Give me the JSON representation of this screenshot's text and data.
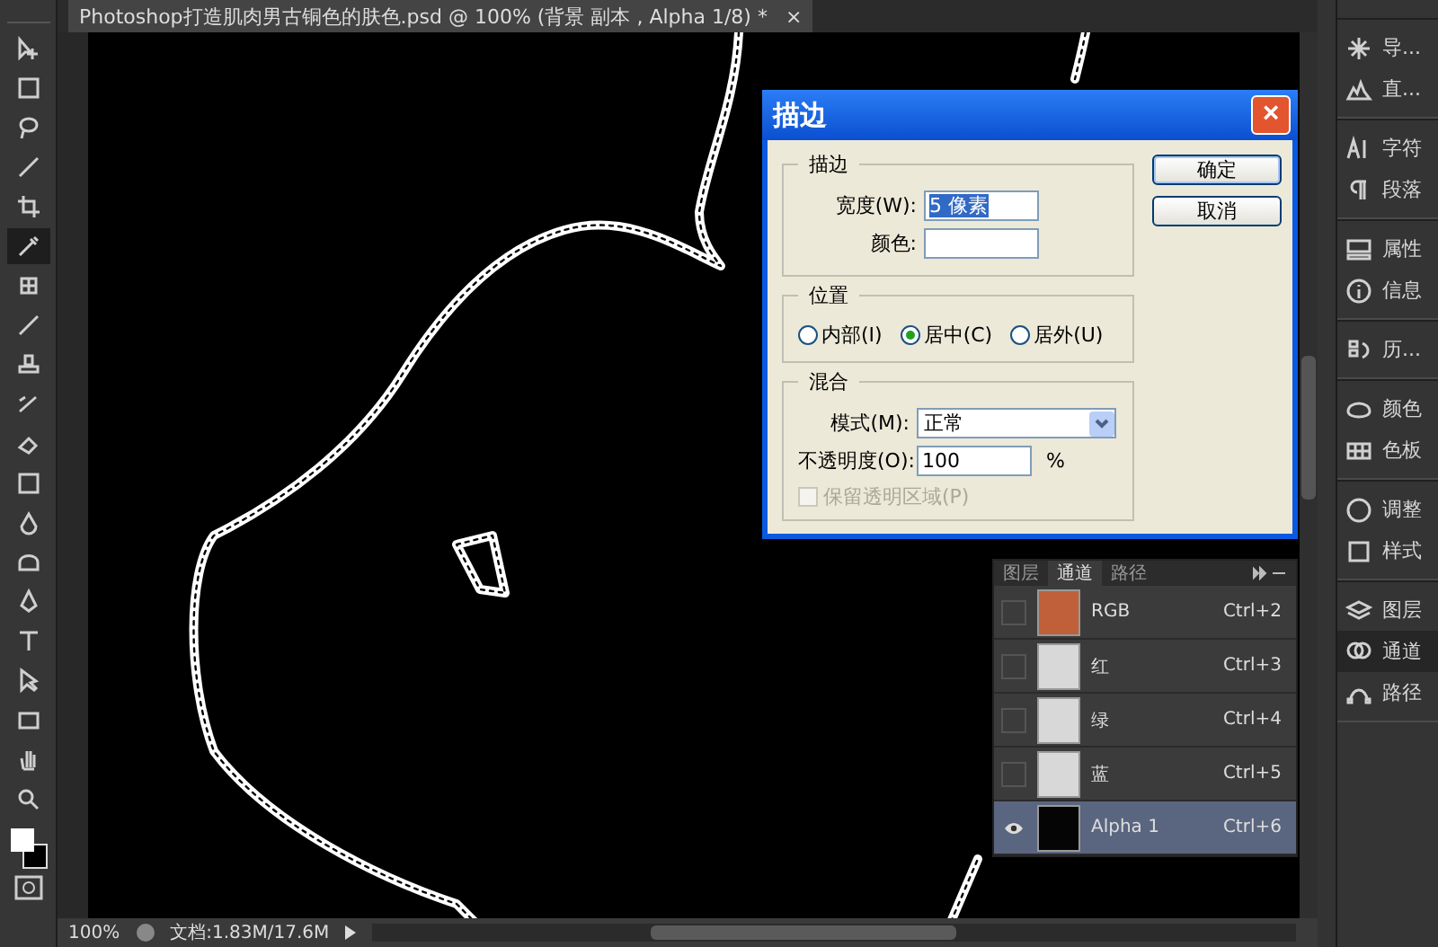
{
  "document_tab": {
    "title": "Photoshop打造肌肉男古铜色的肤色.psd @ 100% (背景 副本 , Alpha 1/8) *",
    "close": "×"
  },
  "tools": [
    {
      "kind": "move",
      "selected": false
    },
    {
      "kind": "marquee",
      "selected": false
    },
    {
      "kind": "lasso",
      "selected": false
    },
    {
      "kind": "brush-select",
      "selected": false
    },
    {
      "kind": "crop",
      "selected": false
    },
    {
      "kind": "eyedropper",
      "selected": true
    },
    {
      "kind": "healing",
      "selected": false
    },
    {
      "kind": "brush",
      "selected": false
    },
    {
      "kind": "stamp",
      "selected": false
    },
    {
      "kind": "history-brush",
      "selected": false
    },
    {
      "kind": "eraser",
      "selected": false
    },
    {
      "kind": "gradient",
      "selected": false
    },
    {
      "kind": "drop",
      "selected": false
    },
    {
      "kind": "dodge",
      "selected": false
    },
    {
      "kind": "pen",
      "selected": false
    },
    {
      "kind": "type",
      "selected": false
    },
    {
      "kind": "arrow",
      "selected": false
    },
    {
      "kind": "rectangle",
      "selected": false
    },
    {
      "kind": "hand",
      "selected": false
    },
    {
      "kind": "zoom",
      "selected": false
    }
  ],
  "dialog": {
    "title": "描边",
    "close": "×",
    "stroke_group": {
      "title": "描边",
      "width_label": "宽度(W):",
      "width_value": "5 像素",
      "color_label": "颜色:",
      "color": "#ffffff"
    },
    "position_group": {
      "title": "位置",
      "options": [
        {
          "label": "内部(I)",
          "selected": false
        },
        {
          "label": "居中(C)",
          "selected": true
        },
        {
          "label": "居外(U)",
          "selected": false
        }
      ]
    },
    "blend_group": {
      "title": "混合",
      "mode_label": "模式(M):",
      "mode_value": "正常",
      "opacity_label": "不透明度(O):",
      "opacity_value": "100",
      "opacity_unit": "%",
      "preserve": {
        "label": "保留透明区域(P)",
        "checked": false,
        "disabled": true
      }
    },
    "buttons": [
      "确定",
      "取消"
    ]
  },
  "channels_panel": {
    "tabs": [
      {
        "label": "图层",
        "selected": false
      },
      {
        "label": "通道",
        "selected": true
      },
      {
        "label": "路径",
        "selected": false
      }
    ],
    "rows": [
      {
        "name": "RGB",
        "shortcut": "Ctrl+2",
        "visible": false,
        "selected": false,
        "kind": "color"
      },
      {
        "name": "红",
        "shortcut": "Ctrl+3",
        "visible": false,
        "selected": false,
        "kind": "gray"
      },
      {
        "name": "绿",
        "shortcut": "Ctrl+4",
        "visible": false,
        "selected": false,
        "kind": "gray"
      },
      {
        "name": "蓝",
        "shortcut": "Ctrl+5",
        "visible": false,
        "selected": false,
        "kind": "gray"
      },
      {
        "name": "Alpha 1",
        "shortcut": "Ctrl+6",
        "visible": true,
        "selected": true,
        "kind": "mask"
      }
    ]
  },
  "dock": [
    {
      "items": [
        {
          "kind": "navigator",
          "label": "导...",
          "selected": false
        },
        {
          "kind": "histogram",
          "label": "直...",
          "selected": false
        }
      ]
    },
    {
      "items": [
        {
          "kind": "character",
          "label": "字符",
          "selected": false
        },
        {
          "kind": "paragraph",
          "label": "段落",
          "selected": false
        }
      ]
    },
    {
      "items": [
        {
          "kind": "properties",
          "label": "属性",
          "selected": false
        },
        {
          "kind": "info",
          "label": "信息",
          "selected": false
        }
      ]
    },
    {
      "items": [
        {
          "kind": "history",
          "label": "历...",
          "selected": false
        }
      ]
    },
    {
      "items": [
        {
          "kind": "color",
          "label": "颜色",
          "selected": false
        },
        {
          "kind": "swatches",
          "label": "色板",
          "selected": false
        }
      ]
    },
    {
      "items": [
        {
          "kind": "adjust",
          "label": "调整",
          "selected": false
        },
        {
          "kind": "styles",
          "label": "样式",
          "selected": false
        }
      ]
    },
    {
      "items": [
        {
          "kind": "layers",
          "label": "图层",
          "selected": false
        },
        {
          "kind": "channels",
          "label": "通道",
          "selected": true
        },
        {
          "kind": "paths",
          "label": "路径",
          "selected": false
        }
      ]
    }
  ],
  "status_bar": {
    "zoom": "100%",
    "doc_info": "文档:1.83M/17.6M"
  }
}
